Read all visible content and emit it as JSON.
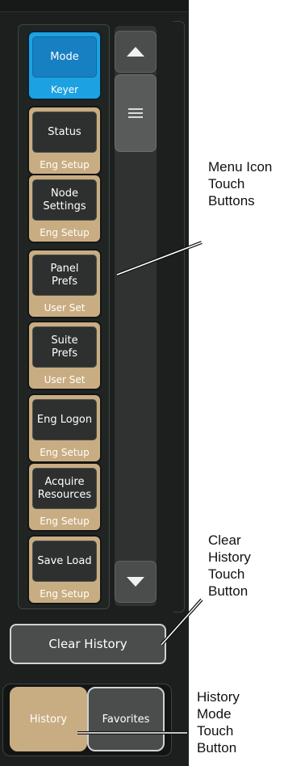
{
  "menu": {
    "buttons": [
      {
        "label": "Mode",
        "sub": "Keyer",
        "active": true
      },
      {
        "label": "Status",
        "sub": "Eng Setup"
      },
      {
        "label": "Node\nSettings",
        "sub": "Eng Setup"
      },
      {
        "label": "Panel\nPrefs",
        "sub": "User Set"
      },
      {
        "label": "Suite\nPrefs",
        "sub": "User Set"
      },
      {
        "label": "Eng Logon",
        "sub": "Eng Setup"
      },
      {
        "label": "Acquire\nResources",
        "sub": "Eng Setup"
      },
      {
        "label": "Save Load",
        "sub": "Eng Setup"
      }
    ]
  },
  "scroll": {
    "up_icon": "up-arrow-icon",
    "down_icon": "down-arrow-icon",
    "thumb_icon": "hamburger-icon"
  },
  "clear_history": {
    "label": "Clear History"
  },
  "modes": {
    "history": "History",
    "favorites": "Favorites",
    "selected": "History"
  },
  "callouts": {
    "menu_icons": "Menu Icon\nTouch\nButtons",
    "clear_history": "Clear\nHistory\nTouch\nButton",
    "history_mode": "History\nMode\nTouch\nButton"
  },
  "colors": {
    "active_mode": "#1780c3",
    "category_tan": "#c9ad82",
    "panel": "#1c1f1e"
  }
}
